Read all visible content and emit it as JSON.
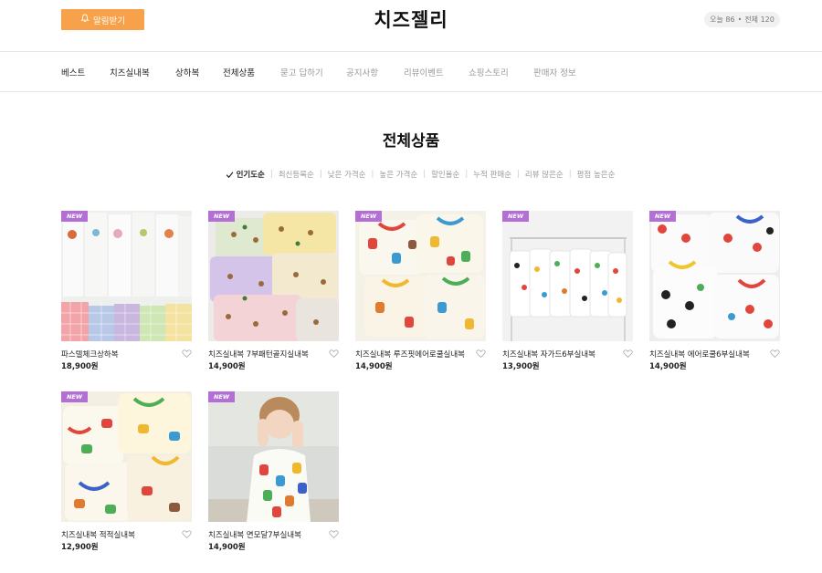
{
  "header": {
    "notify_label": "알림받기",
    "brand": "치즈젤리",
    "counter_today": "오늘 86",
    "counter_sep": "•",
    "counter_total": "전체 120"
  },
  "nav": {
    "items": [
      {
        "label": "베스트"
      },
      {
        "label": "치즈실내복"
      },
      {
        "label": "상하복"
      },
      {
        "label": "전체상품"
      },
      {
        "label": "묻고 답하기"
      },
      {
        "label": "공지사항"
      },
      {
        "label": "리뷰이벤트"
      },
      {
        "label": "쇼핑스토리"
      },
      {
        "label": "판매자 정보"
      }
    ]
  },
  "main": {
    "title": "전체상품",
    "sort_options": [
      {
        "label": "인기도순",
        "active": true
      },
      {
        "label": "최신등록순"
      },
      {
        "label": "낮은 가격순"
      },
      {
        "label": "높은 가격순"
      },
      {
        "label": "할인율순"
      },
      {
        "label": "누적 판매순"
      },
      {
        "label": "리뷰 많은순"
      },
      {
        "label": "평점 높은순"
      }
    ],
    "badge_label": "NEW",
    "products": [
      {
        "name": "파스텔체크상하복",
        "price": "18,900원"
      },
      {
        "name": "치즈실내복 7부패턴골지실내복",
        "price": "14,900원"
      },
      {
        "name": "치즈실내복 루즈핏에어로쿨실내복",
        "price": "14,900원"
      },
      {
        "name": "치즈실내복 자가드6부실내복",
        "price": "13,900원"
      },
      {
        "name": "치즈실내복 에어로쿨6부실내복",
        "price": "14,900원"
      },
      {
        "name": "치즈실내복 적적실내복",
        "price": "12,900원"
      },
      {
        "name": "치즈실내복 면모달7부실내복",
        "price": "14,900원"
      }
    ]
  },
  "colors": {
    "notify_button": "#f7a24a",
    "new_badge": "#b36fd6"
  }
}
